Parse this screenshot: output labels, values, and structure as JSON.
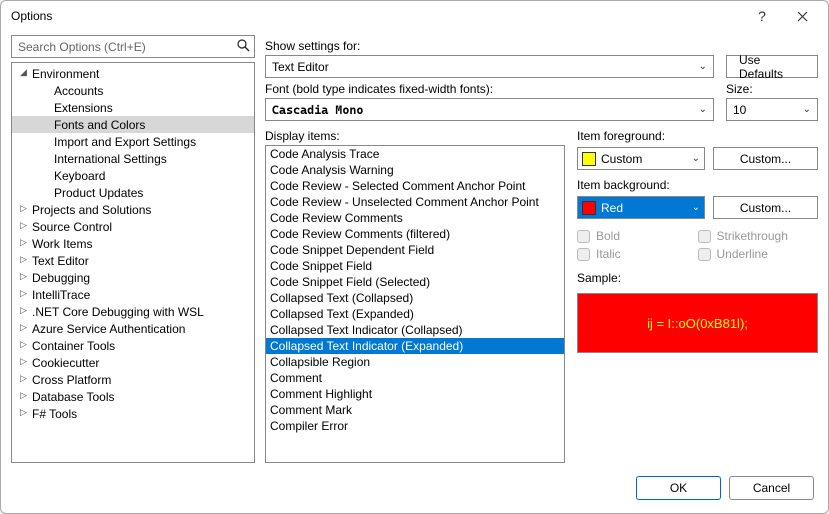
{
  "window": {
    "title": "Options"
  },
  "search": {
    "placeholder": "Search Options (Ctrl+E)"
  },
  "tree": {
    "items": [
      {
        "label": "Environment",
        "level": 0,
        "expander": "◢",
        "selected": false
      },
      {
        "label": "Accounts",
        "level": 1,
        "expander": "",
        "selected": false
      },
      {
        "label": "Extensions",
        "level": 1,
        "expander": "",
        "selected": false
      },
      {
        "label": "Fonts and Colors",
        "level": 1,
        "expander": "",
        "selected": true
      },
      {
        "label": "Import and Export Settings",
        "level": 1,
        "expander": "",
        "selected": false
      },
      {
        "label": "International Settings",
        "level": 1,
        "expander": "",
        "selected": false
      },
      {
        "label": "Keyboard",
        "level": 1,
        "expander": "",
        "selected": false
      },
      {
        "label": "Product Updates",
        "level": 1,
        "expander": "",
        "selected": false
      },
      {
        "label": "Projects and Solutions",
        "level": 0,
        "expander": "▷",
        "selected": false
      },
      {
        "label": "Source Control",
        "level": 0,
        "expander": "▷",
        "selected": false
      },
      {
        "label": "Work Items",
        "level": 0,
        "expander": "▷",
        "selected": false
      },
      {
        "label": "Text Editor",
        "level": 0,
        "expander": "▷",
        "selected": false
      },
      {
        "label": "Debugging",
        "level": 0,
        "expander": "▷",
        "selected": false
      },
      {
        "label": "IntelliTrace",
        "level": 0,
        "expander": "▷",
        "selected": false
      },
      {
        "label": ".NET Core Debugging with WSL",
        "level": 0,
        "expander": "▷",
        "selected": false
      },
      {
        "label": "Azure Service Authentication",
        "level": 0,
        "expander": "▷",
        "selected": false
      },
      {
        "label": "Container Tools",
        "level": 0,
        "expander": "▷",
        "selected": false
      },
      {
        "label": "Cookiecutter",
        "level": 0,
        "expander": "▷",
        "selected": false
      },
      {
        "label": "Cross Platform",
        "level": 0,
        "expander": "▷",
        "selected": false
      },
      {
        "label": "Database Tools",
        "level": 0,
        "expander": "▷",
        "selected": false
      },
      {
        "label": "F# Tools",
        "level": 0,
        "expander": "▷",
        "selected": false
      }
    ]
  },
  "settings": {
    "show_label": "Show settings for:",
    "show_value": "Text Editor",
    "use_defaults": "Use Defaults",
    "font_label": "Font (bold type indicates fixed-width fonts):",
    "font_value": "Cascadia Mono",
    "size_label": "Size:",
    "size_value": "10",
    "display_label": "Display items:",
    "display_items": [
      "Code Analysis Trace",
      "Code Analysis Warning",
      "Code Review - Selected Comment Anchor Point",
      "Code Review - Unselected Comment Anchor Point",
      "Code Review Comments",
      "Code Review Comments (filtered)",
      "Code Snippet Dependent Field",
      "Code Snippet Field",
      "Code Snippet Field (Selected)",
      "Collapsed Text (Collapsed)",
      "Collapsed Text (Expanded)",
      "Collapsed Text Indicator (Collapsed)",
      "Collapsed Text Indicator (Expanded)",
      "Collapsible Region",
      "Comment",
      "Comment Highlight",
      "Comment Mark",
      "Compiler Error"
    ],
    "display_selected_index": 12,
    "fg_label": "Item foreground:",
    "fg_value": "Custom",
    "bg_label": "Item background:",
    "bg_value": "Red",
    "custom_btn": "Custom...",
    "bold": "Bold",
    "italic": "Italic",
    "strike": "Strikethrough",
    "underline": "Underline",
    "sample_label": "Sample:",
    "sample_text": "ij = I::oO(0xB81l);"
  },
  "footer": {
    "ok": "OK",
    "cancel": "Cancel"
  }
}
